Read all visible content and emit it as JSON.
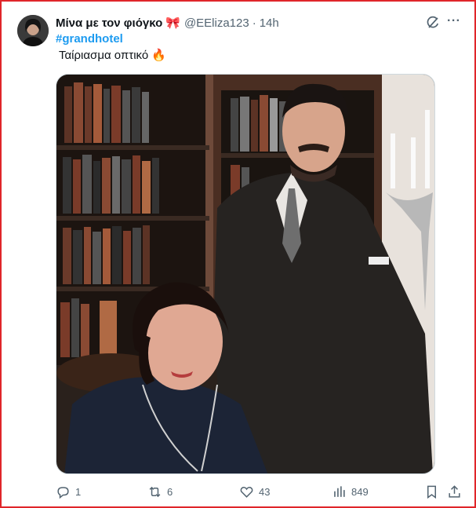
{
  "author": {
    "display_name": "Μίνα με τον φιόγκο",
    "emoji": "🎀",
    "handle": "@EEliza123",
    "separator": "·",
    "time": "14h"
  },
  "tweet": {
    "hashtag": "#grandhotel",
    "text": "Ταίριασμα οπτικό 🔥"
  },
  "actions": {
    "replies": "1",
    "reposts": "6",
    "likes": "43",
    "views": "849"
  },
  "menu": {
    "more_label": "···"
  },
  "colors": {
    "accent": "#1d9bf0",
    "secondary_text": "#536471",
    "frame": "#e0262a"
  },
  "icons": [
    "grok-icon",
    "more-icon",
    "reply-icon",
    "repost-icon",
    "like-icon",
    "views-icon",
    "bookmark-icon",
    "share-icon"
  ]
}
